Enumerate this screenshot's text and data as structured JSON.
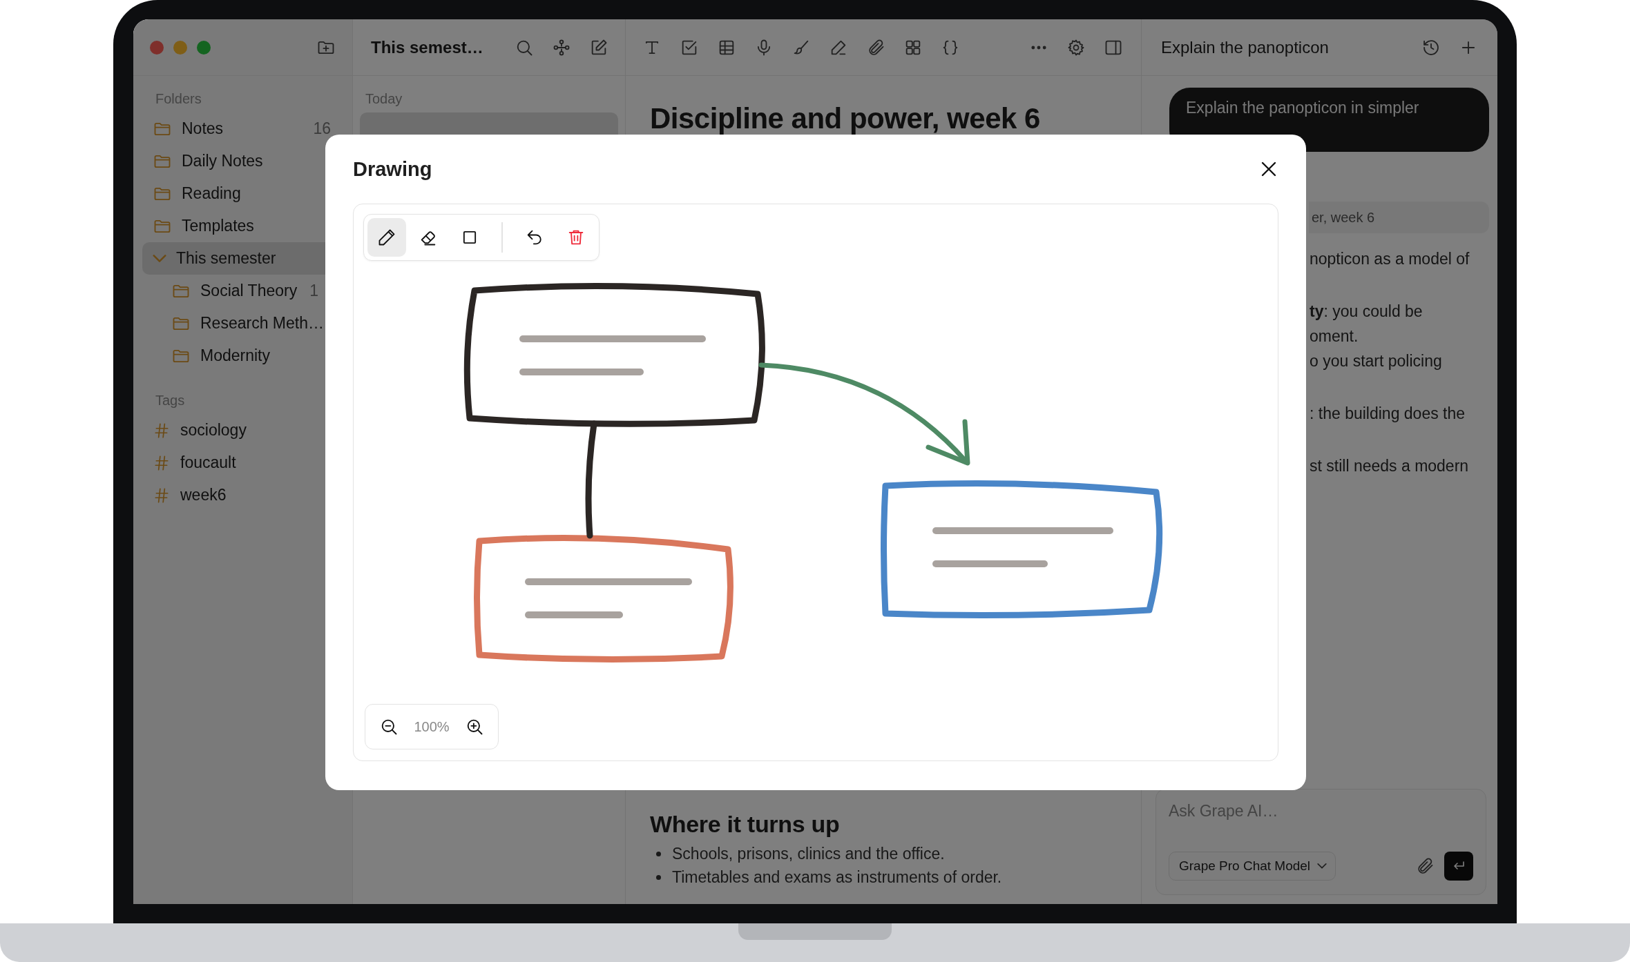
{
  "sidebar": {
    "folders_heading": "Folders",
    "folders": [
      {
        "name": "Notes",
        "count": "16",
        "selected": false,
        "expanded": false
      },
      {
        "name": "Daily Notes",
        "selected": false,
        "expanded": false
      },
      {
        "name": "Reading",
        "selected": false,
        "expanded": false
      },
      {
        "name": "Templates",
        "selected": false,
        "expanded": false
      },
      {
        "name": "This semester",
        "selected": true,
        "expanded": true,
        "children": [
          {
            "name": "Social Theory",
            "count": "1",
            "selected": false
          },
          {
            "name": "Research Meth…",
            "selected": false
          },
          {
            "name": "Modernity",
            "selected": false
          }
        ]
      }
    ],
    "tags_heading": "Tags",
    "tags": [
      "sociology",
      "foucault",
      "week6"
    ]
  },
  "note_list": {
    "title": "This semest…",
    "section": "Today",
    "notes": [
      {
        "selected": true
      }
    ]
  },
  "editor": {
    "title": "Discipline and power, week 6",
    "heading": "Where it turns up",
    "bullets": [
      "Schools, prisons, clinics and the office.",
      "Timetables and exams as instruments of order."
    ]
  },
  "assistant": {
    "title": "Explain the panopticon",
    "user_message": "Explain the panopticon in simpler",
    "source_chip": "er, week 6",
    "reply": [
      [
        "nopticon as a model of"
      ],
      [
        "**ty**: you could be",
        "oment.",
        "o you start policing"
      ],
      [
        ": the building does the"
      ],
      [
        "st still needs a modern"
      ]
    ],
    "placeholder": "Ask Grape AI…",
    "model": "Grape Pro Chat Model"
  },
  "drawing_dialog": {
    "title": "Drawing",
    "tools": [
      {
        "kind": "pen",
        "selected": true
      },
      {
        "kind": "eraser",
        "selected": false
      },
      {
        "kind": "rectangle",
        "selected": false
      }
    ],
    "shapes": [
      {
        "kind": "box",
        "color": "#2b2624"
      },
      {
        "kind": "box",
        "color": "#d9775c"
      },
      {
        "kind": "box",
        "color": "#4a86c8"
      },
      {
        "kind": "connector",
        "color": "#2b2624"
      },
      {
        "kind": "arrow",
        "color": "#4e8a64"
      }
    ],
    "zoom": "100%"
  }
}
